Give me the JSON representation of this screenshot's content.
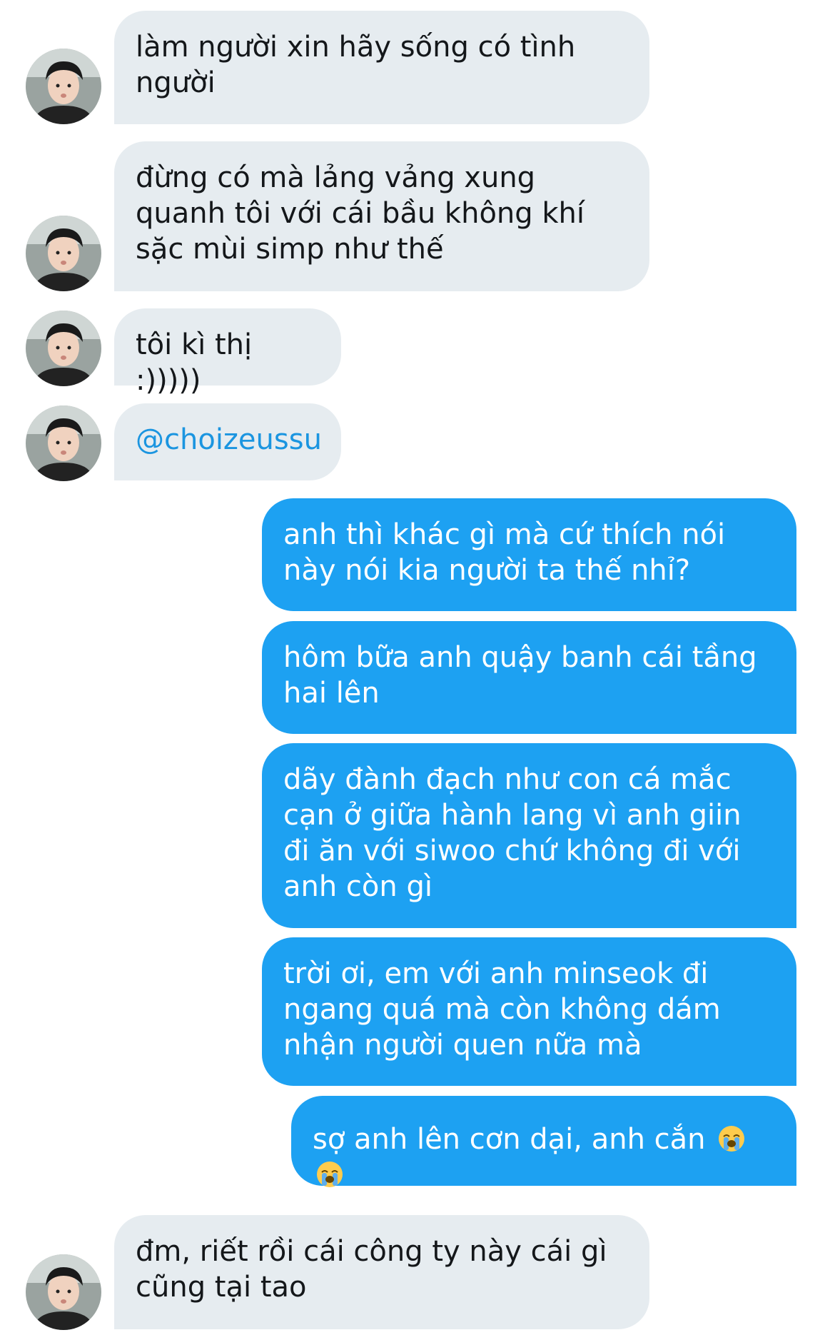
{
  "conversation": {
    "messages": [
      {
        "from": "them",
        "text": "làm người xin hãy sống có tình người"
      },
      {
        "from": "them",
        "text": "đừng có mà lảng vảng xung quanh tôi với cái bầu không khí sặc mùi simp như thế"
      },
      {
        "from": "them",
        "text": "tôi kì thị :)))))"
      },
      {
        "from": "them",
        "text": "@choizeussu"
      },
      {
        "from": "me",
        "text": "anh thì khác gì mà cứ thích nói này nói kia người ta thế nhỉ?"
      },
      {
        "from": "me",
        "text": "hôm bữa anh quậy banh cái tầng hai lên"
      },
      {
        "from": "me",
        "text": "dãy đành đạch như con cá mắc cạn ở giữa hành lang vì anh giin đi ăn với siwoo chứ không đi với anh còn gì"
      },
      {
        "from": "me",
        "text": "trời ơi, em với anh minseok đi ngang quá mà còn không dám nhận người quen nữa mà"
      },
      {
        "from": "me",
        "text": "sợ anh lên cơn dại, anh cắn",
        "emoji": [
          "loudly-crying-face-emoji",
          "loudly-crying-face-emoji"
        ]
      },
      {
        "from": "them",
        "text": "đm, riết rồi cái công ty này cái gì cũng tại tao"
      }
    ]
  },
  "colors": {
    "incoming_bubble": "#e6ecf0",
    "outgoing_bubble": "#1da1f2",
    "mention": "#1b95e0",
    "incoming_text": "#14171a",
    "outgoing_text": "#ffffff"
  },
  "icons": {
    "avatar": "avatar-photo",
    "emoji": "loudly-crying-face-emoji"
  }
}
